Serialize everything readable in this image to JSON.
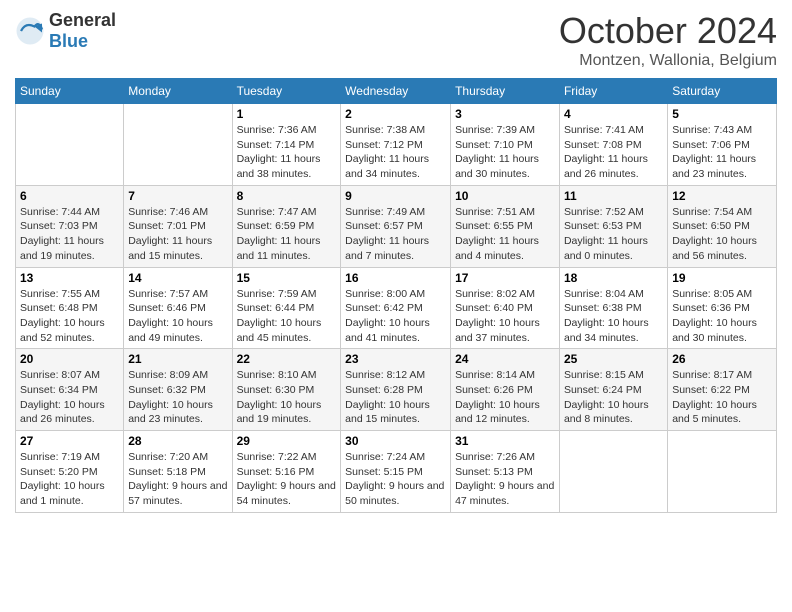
{
  "header": {
    "logo": {
      "general": "General",
      "blue": "Blue"
    },
    "title": "October 2024",
    "subtitle": "Montzen, Wallonia, Belgium"
  },
  "calendar": {
    "days_of_week": [
      "Sunday",
      "Monday",
      "Tuesday",
      "Wednesday",
      "Thursday",
      "Friday",
      "Saturday"
    ],
    "weeks": [
      [
        {
          "day": "",
          "sunrise": "",
          "sunset": "",
          "daylight": ""
        },
        {
          "day": "",
          "sunrise": "",
          "sunset": "",
          "daylight": ""
        },
        {
          "day": "1",
          "sunrise": "Sunrise: 7:36 AM",
          "sunset": "Sunset: 7:14 PM",
          "daylight": "Daylight: 11 hours and 38 minutes."
        },
        {
          "day": "2",
          "sunrise": "Sunrise: 7:38 AM",
          "sunset": "Sunset: 7:12 PM",
          "daylight": "Daylight: 11 hours and 34 minutes."
        },
        {
          "day": "3",
          "sunrise": "Sunrise: 7:39 AM",
          "sunset": "Sunset: 7:10 PM",
          "daylight": "Daylight: 11 hours and 30 minutes."
        },
        {
          "day": "4",
          "sunrise": "Sunrise: 7:41 AM",
          "sunset": "Sunset: 7:08 PM",
          "daylight": "Daylight: 11 hours and 26 minutes."
        },
        {
          "day": "5",
          "sunrise": "Sunrise: 7:43 AM",
          "sunset": "Sunset: 7:06 PM",
          "daylight": "Daylight: 11 hours and 23 minutes."
        }
      ],
      [
        {
          "day": "6",
          "sunrise": "Sunrise: 7:44 AM",
          "sunset": "Sunset: 7:03 PM",
          "daylight": "Daylight: 11 hours and 19 minutes."
        },
        {
          "day": "7",
          "sunrise": "Sunrise: 7:46 AM",
          "sunset": "Sunset: 7:01 PM",
          "daylight": "Daylight: 11 hours and 15 minutes."
        },
        {
          "day": "8",
          "sunrise": "Sunrise: 7:47 AM",
          "sunset": "Sunset: 6:59 PM",
          "daylight": "Daylight: 11 hours and 11 minutes."
        },
        {
          "day": "9",
          "sunrise": "Sunrise: 7:49 AM",
          "sunset": "Sunset: 6:57 PM",
          "daylight": "Daylight: 11 hours and 7 minutes."
        },
        {
          "day": "10",
          "sunrise": "Sunrise: 7:51 AM",
          "sunset": "Sunset: 6:55 PM",
          "daylight": "Daylight: 11 hours and 4 minutes."
        },
        {
          "day": "11",
          "sunrise": "Sunrise: 7:52 AM",
          "sunset": "Sunset: 6:53 PM",
          "daylight": "Daylight: 11 hours and 0 minutes."
        },
        {
          "day": "12",
          "sunrise": "Sunrise: 7:54 AM",
          "sunset": "Sunset: 6:50 PM",
          "daylight": "Daylight: 10 hours and 56 minutes."
        }
      ],
      [
        {
          "day": "13",
          "sunrise": "Sunrise: 7:55 AM",
          "sunset": "Sunset: 6:48 PM",
          "daylight": "Daylight: 10 hours and 52 minutes."
        },
        {
          "day": "14",
          "sunrise": "Sunrise: 7:57 AM",
          "sunset": "Sunset: 6:46 PM",
          "daylight": "Daylight: 10 hours and 49 minutes."
        },
        {
          "day": "15",
          "sunrise": "Sunrise: 7:59 AM",
          "sunset": "Sunset: 6:44 PM",
          "daylight": "Daylight: 10 hours and 45 minutes."
        },
        {
          "day": "16",
          "sunrise": "Sunrise: 8:00 AM",
          "sunset": "Sunset: 6:42 PM",
          "daylight": "Daylight: 10 hours and 41 minutes."
        },
        {
          "day": "17",
          "sunrise": "Sunrise: 8:02 AM",
          "sunset": "Sunset: 6:40 PM",
          "daylight": "Daylight: 10 hours and 37 minutes."
        },
        {
          "day": "18",
          "sunrise": "Sunrise: 8:04 AM",
          "sunset": "Sunset: 6:38 PM",
          "daylight": "Daylight: 10 hours and 34 minutes."
        },
        {
          "day": "19",
          "sunrise": "Sunrise: 8:05 AM",
          "sunset": "Sunset: 6:36 PM",
          "daylight": "Daylight: 10 hours and 30 minutes."
        }
      ],
      [
        {
          "day": "20",
          "sunrise": "Sunrise: 8:07 AM",
          "sunset": "Sunset: 6:34 PM",
          "daylight": "Daylight: 10 hours and 26 minutes."
        },
        {
          "day": "21",
          "sunrise": "Sunrise: 8:09 AM",
          "sunset": "Sunset: 6:32 PM",
          "daylight": "Daylight: 10 hours and 23 minutes."
        },
        {
          "day": "22",
          "sunrise": "Sunrise: 8:10 AM",
          "sunset": "Sunset: 6:30 PM",
          "daylight": "Daylight: 10 hours and 19 minutes."
        },
        {
          "day": "23",
          "sunrise": "Sunrise: 8:12 AM",
          "sunset": "Sunset: 6:28 PM",
          "daylight": "Daylight: 10 hours and 15 minutes."
        },
        {
          "day": "24",
          "sunrise": "Sunrise: 8:14 AM",
          "sunset": "Sunset: 6:26 PM",
          "daylight": "Daylight: 10 hours and 12 minutes."
        },
        {
          "day": "25",
          "sunrise": "Sunrise: 8:15 AM",
          "sunset": "Sunset: 6:24 PM",
          "daylight": "Daylight: 10 hours and 8 minutes."
        },
        {
          "day": "26",
          "sunrise": "Sunrise: 8:17 AM",
          "sunset": "Sunset: 6:22 PM",
          "daylight": "Daylight: 10 hours and 5 minutes."
        }
      ],
      [
        {
          "day": "27",
          "sunrise": "Sunrise: 7:19 AM",
          "sunset": "Sunset: 5:20 PM",
          "daylight": "Daylight: 10 hours and 1 minute."
        },
        {
          "day": "28",
          "sunrise": "Sunrise: 7:20 AM",
          "sunset": "Sunset: 5:18 PM",
          "daylight": "Daylight: 9 hours and 57 minutes."
        },
        {
          "day": "29",
          "sunrise": "Sunrise: 7:22 AM",
          "sunset": "Sunset: 5:16 PM",
          "daylight": "Daylight: 9 hours and 54 minutes."
        },
        {
          "day": "30",
          "sunrise": "Sunrise: 7:24 AM",
          "sunset": "Sunset: 5:15 PM",
          "daylight": "Daylight: 9 hours and 50 minutes."
        },
        {
          "day": "31",
          "sunrise": "Sunrise: 7:26 AM",
          "sunset": "Sunset: 5:13 PM",
          "daylight": "Daylight: 9 hours and 47 minutes."
        },
        {
          "day": "",
          "sunrise": "",
          "sunset": "",
          "daylight": ""
        },
        {
          "day": "",
          "sunrise": "",
          "sunset": "",
          "daylight": ""
        }
      ]
    ]
  }
}
